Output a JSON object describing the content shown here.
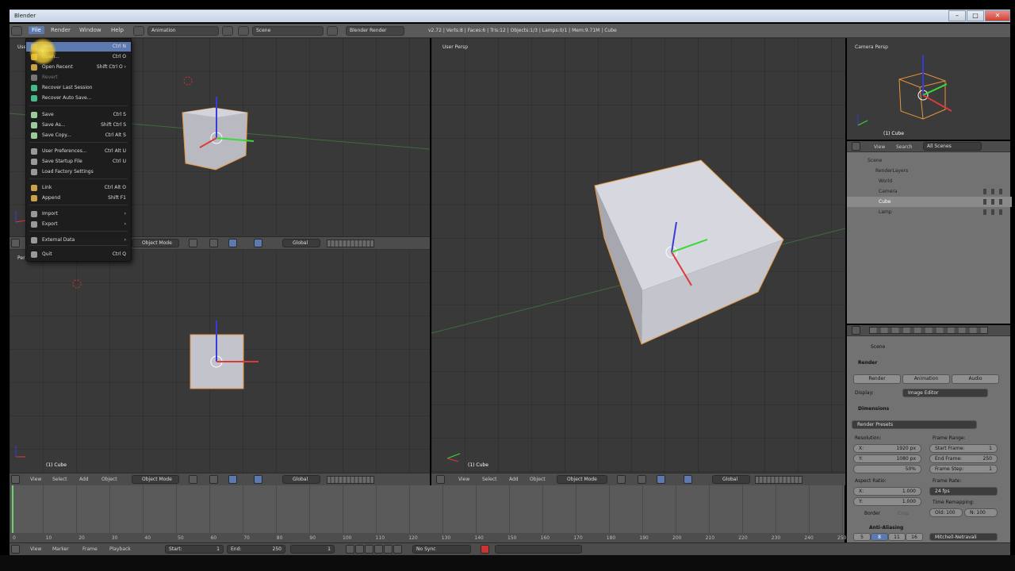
{
  "window": {
    "title": "Blender",
    "min_icon": "minimize-icon",
    "max_icon": "maximize-icon",
    "close_glyph": "✕"
  },
  "infobar": {
    "menus": [
      "File",
      "Render",
      "Window",
      "Help"
    ],
    "layout": "Animation",
    "scene": "Scene",
    "engine": "Blender Render",
    "stats": "v2.72 | Verts:8 | Faces:6 | Tris:12 | Objects:1/3 | Lamps:0/1 | Mem:9.71M | Cube"
  },
  "file_menu": {
    "items": [
      {
        "label": "New",
        "shortcut": "Ctrl N",
        "highlight": true
      },
      {
        "label": "Open...",
        "shortcut": "Ctrl O"
      },
      {
        "label": "Open Recent",
        "shortcut": "Shift Ctrl O ›"
      },
      {
        "label": "Revert",
        "shortcut": "",
        "dim": true
      },
      {
        "label": "Recover Last Session",
        "shortcut": ""
      },
      {
        "label": "Recover Auto Save...",
        "shortcut": ""
      },
      {
        "label": "Save",
        "shortcut": "Ctrl S"
      },
      {
        "label": "Save As...",
        "shortcut": "Shift Ctrl S"
      },
      {
        "label": "Save Copy...",
        "shortcut": "Ctrl Alt S"
      },
      {
        "label": "User Preferences...",
        "shortcut": "Ctrl Alt U"
      },
      {
        "label": "Save Startup File",
        "shortcut": "Ctrl U"
      },
      {
        "label": "Load Factory Settings",
        "shortcut": ""
      },
      {
        "label": "Link",
        "shortcut": "Ctrl Alt O"
      },
      {
        "label": "Append",
        "shortcut": "Shift F1"
      },
      {
        "label": "Import",
        "shortcut": "›"
      },
      {
        "label": "Export",
        "shortcut": "›"
      },
      {
        "label": "External Data",
        "shortcut": "›"
      },
      {
        "label": "Quit",
        "shortcut": "Ctrl Q"
      }
    ]
  },
  "viewports": {
    "top_left": {
      "label": "User",
      "footer": ""
    },
    "bottom_left": {
      "label": "Persp",
      "footer": "(1) Cube"
    },
    "right": {
      "label": "User Persp",
      "footer": "(1) Cube"
    },
    "camera": {
      "label": "Camera Persp",
      "footer": "(1) Cube"
    }
  },
  "view_header": {
    "menus": [
      "View",
      "Select",
      "Add",
      "Object"
    ],
    "mode": "Object Mode",
    "orientation": "Global"
  },
  "outliner": {
    "menus": [
      "View",
      "Search"
    ],
    "filter": "All Scenes",
    "rows": [
      "Scene",
      "RenderLayers",
      "World",
      "Camera",
      "Cube",
      "Lamp"
    ]
  },
  "properties": {
    "scene_label": "Scene",
    "render_section": "Render",
    "render_buttons": [
      "Render",
      "Animation",
      "Audio"
    ],
    "display_label": "Display:",
    "display_value": "Image Editor",
    "dimensions_section": "Dimensions",
    "render_presets": "Render Presets",
    "resolution_label": "Resolution:",
    "res_x": "X:",
    "res_x_value": "1920 px",
    "res_y": "Y:",
    "res_y_value": "1080 px",
    "res_percent": "50%",
    "frame_range_label": "Frame Range:",
    "start_frame": "Start Frame:",
    "start_frame_value": "1",
    "end_frame": "End Frame:",
    "end_frame_value": "250",
    "frame_step": "Frame Step:",
    "frame_step_value": "1",
    "aspect_label": "Aspect Ratio:",
    "asp_x": "X:",
    "asp_x_value": "1.000",
    "asp_y": "Y:",
    "asp_y_value": "1.000",
    "frame_rate_label": "Frame Rate:",
    "frame_rate": "24 fps",
    "time_remap_label": "Time Remapping:",
    "remap_old": "Old: 100",
    "remap_new": "N: 100",
    "border_label": "Border",
    "crop_label": "Crop",
    "aa_section": "Anti-Aliasing",
    "aa_samples": [
      "5",
      "8",
      "11",
      "16"
    ],
    "aa_filter": "Mitchell-Netravali"
  },
  "timeline": {
    "ticks": [
      "0",
      "10",
      "20",
      "30",
      "40",
      "50",
      "60",
      "70",
      "80",
      "90",
      "100",
      "110",
      "120",
      "130",
      "140",
      "150",
      "160",
      "170",
      "180",
      "190",
      "200",
      "210",
      "220",
      "230",
      "240",
      "250"
    ],
    "menus": [
      "View",
      "Marker",
      "Frame",
      "Playback"
    ],
    "start": "Start:",
    "start_value": "1",
    "end": "End:",
    "end_value": "250",
    "current": "1",
    "sync": "No Sync"
  },
  "colors": {
    "accent": "#5d7ab0",
    "viewport_bg": "#393939",
    "panel_bg": "#727272",
    "cube_face": "#c9c9d1",
    "select_orange": "#e8943a",
    "axis_x": "#d93a3a",
    "axis_y": "#3ad93a",
    "axis_z": "#3a3ad9"
  }
}
